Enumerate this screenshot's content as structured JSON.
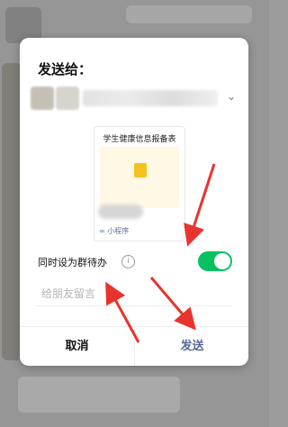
{
  "dialog": {
    "title": "发送给：",
    "card": {
      "title": "学生健康信息报备表",
      "source_label": "小程序"
    },
    "todo": {
      "label": "同时设为群待办",
      "info_icon": "ⓘ",
      "enabled": true
    },
    "message": {
      "placeholder": "给朋友留言"
    },
    "buttons": {
      "cancel": "取消",
      "send": "发送"
    }
  },
  "colors": {
    "accent_green": "#07c160",
    "send_text": "#576b95",
    "arrow_red": "#e8342f"
  },
  "annotations": {
    "arrow_count": 3
  }
}
